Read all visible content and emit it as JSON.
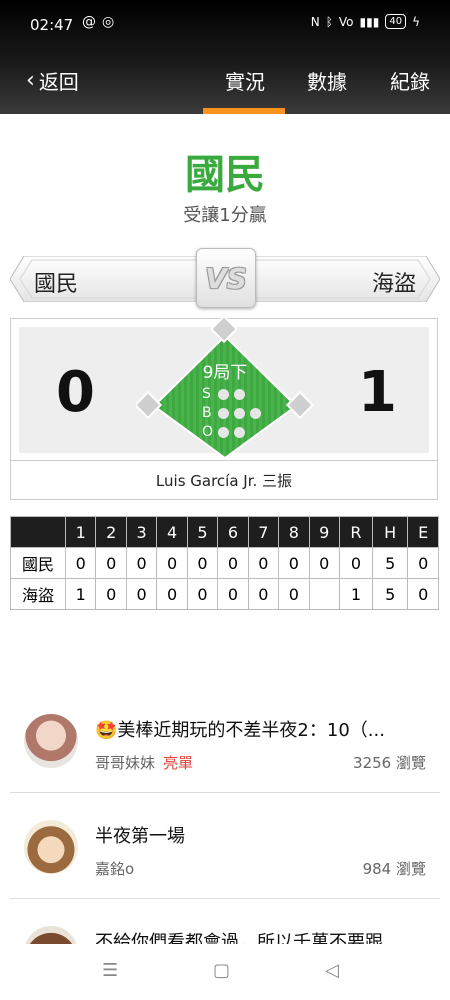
{
  "status_bar": {
    "time": "02:47",
    "battery": "40"
  },
  "header": {
    "back_label": "返回",
    "tabs": [
      "實況",
      "數據",
      "紀錄"
    ],
    "active_tab": "實況"
  },
  "result": {
    "winner": "國民",
    "description": "受讓1分贏"
  },
  "matchup": {
    "home_team": "國民",
    "away_team": "海盜",
    "vs_label": "VS"
  },
  "score": {
    "home": "0",
    "away": "1",
    "inning": "9局下",
    "count_labels": [
      "S",
      "B",
      "O"
    ],
    "strikes": 0,
    "balls": 0,
    "outs": 0
  },
  "last_play": "Luis García Jr. 三振",
  "linescore": {
    "headers": [
      "",
      "1",
      "2",
      "3",
      "4",
      "5",
      "6",
      "7",
      "8",
      "9",
      "R",
      "H",
      "E"
    ],
    "rows": [
      [
        "國民",
        "0",
        "0",
        "0",
        "0",
        "0",
        "0",
        "0",
        "0",
        "0",
        "0",
        "5",
        "0"
      ],
      [
        "海盜",
        "1",
        "0",
        "0",
        "0",
        "0",
        "0",
        "0",
        "0",
        "",
        "1",
        "5",
        "0"
      ]
    ]
  },
  "posts": [
    {
      "title": "🤩美棒近期玩的不差半夜2：10（...",
      "author": "哥哥妹妹",
      "tag": "亮單",
      "views": "3256 瀏覽"
    },
    {
      "title": "半夜第一場",
      "author": "嘉銘o",
      "tag": "",
      "views": "984 瀏覽"
    },
    {
      "title": "不給你們看都會過，所以千萬不要跟",
      "author": "",
      "tag": "",
      "views": ""
    }
  ],
  "colors": {
    "accent": "#f7931e",
    "field_green": "#3aaa3f",
    "tag_red": "#e0453a"
  }
}
